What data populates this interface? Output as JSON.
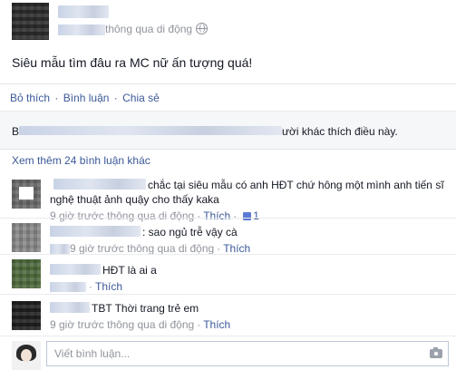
{
  "post": {
    "meta_text": "thông qua di động",
    "text": "Siêu mẫu tìm đâu ra MC nữ ấn tượng quá!"
  },
  "actions": {
    "like": "Bỏ thích",
    "comment": "Bình luận",
    "share": "Chia sẻ",
    "separator": "·"
  },
  "likes": {
    "prefix": "B",
    "suffix": "ười khác thích điều này."
  },
  "more_comments": "Xem thêm 24 bình luận khác",
  "comments": [
    {
      "text": "chắc tại siêu mẫu có anh HĐT chứ hông một mình anh tiến sĩ nghệ thuật ảnh quậy cho thấy kaka",
      "time": "9 giờ trước thông qua di động",
      "action": "Thích",
      "like_count": "1"
    },
    {
      "text": ": sao ngủ trễ vậy cà",
      "time": "9 giờ trước thông qua di động",
      "action": "Thích"
    },
    {
      "text": "HĐT là ai a",
      "action": "Thích"
    },
    {
      "text": "TBT Thời trang trẻ em",
      "time": "9 giờ trước thông qua di động",
      "action": "Thích"
    }
  ],
  "compose": {
    "placeholder": "Viết bình luận..."
  },
  "icons": [
    "globe-icon",
    "thumb-up-icon",
    "camera-icon",
    "chevron-down-icon"
  ],
  "colors": {
    "link": "#3b5998",
    "muted": "#90949c",
    "text": "#141823",
    "likes_bg": "#f6f7f9"
  }
}
